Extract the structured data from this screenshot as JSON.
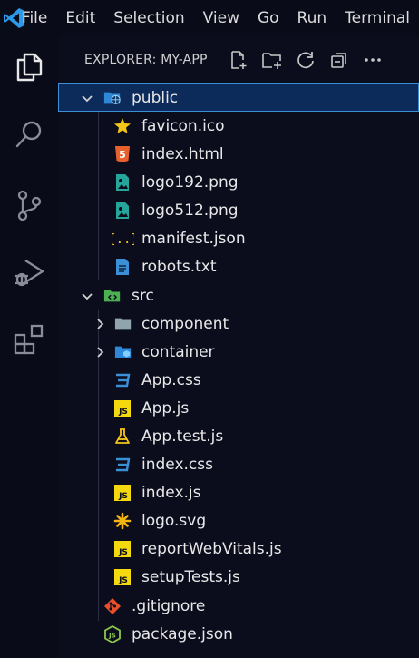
{
  "menu": {
    "items": [
      "File",
      "Edit",
      "Selection",
      "View",
      "Go",
      "Run",
      "Terminal"
    ]
  },
  "explorer": {
    "title": "EXPLORER: MY-APP"
  },
  "tree": {
    "public_folder": "public",
    "public_files": [
      "favicon.ico",
      "index.html",
      "logo192.png",
      "logo512.png",
      "manifest.json",
      "robots.txt"
    ],
    "src_folder": "src",
    "src_subfolders": [
      "component",
      "container"
    ],
    "src_files": [
      "App.css",
      "App.js",
      "App.test.js",
      "index.css",
      "index.js",
      "logo.svg",
      "reportWebVitals.js",
      "setupTests.js"
    ],
    "root_files": [
      ".gitignore",
      "package.json"
    ]
  },
  "colors": {
    "accent": "#0a7bd4",
    "selection_bg": "#0c2a5a",
    "selection_border": "#3b8fd6",
    "js_yellow": "#f5d90f",
    "css_blue": "#3b8fd6",
    "html_orange": "#e8602c",
    "image_teal": "#26a69a",
    "node_green": "#8cc84b"
  },
  "icons": {
    "activity_bar": [
      "files-icon",
      "search-icon",
      "source-control-icon",
      "run-debug-icon",
      "extensions-icon"
    ],
    "header_actions": [
      "new-file-icon",
      "new-folder-icon",
      "refresh-icon",
      "collapse-all-icon",
      "more-icon"
    ]
  }
}
